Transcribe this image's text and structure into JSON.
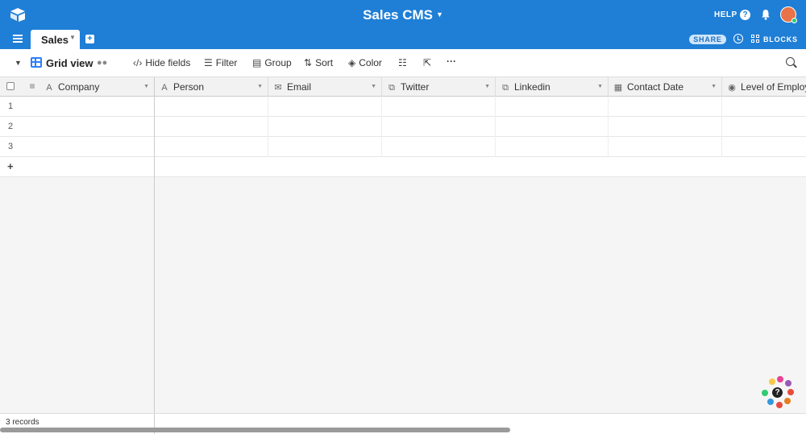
{
  "app": {
    "base_title": "Sales CMS",
    "help_label": "HELP",
    "share_label": "SHARE",
    "blocks_label": "BLOCKS",
    "tabs": [
      {
        "label": "Sales"
      }
    ]
  },
  "toolbar": {
    "view_name": "Grid view",
    "hide_fields": "Hide fields",
    "filter": "Filter",
    "group": "Group",
    "sort": "Sort",
    "color": "Color",
    "more": "···"
  },
  "grid": {
    "primary_column": {
      "label": "Company",
      "icon": "text-icon"
    },
    "columns": [
      {
        "label": "Person",
        "icon": "text-icon"
      },
      {
        "label": "Email",
        "icon": "email-icon"
      },
      {
        "label": "Twitter",
        "icon": "link-icon"
      },
      {
        "label": "Linkedin",
        "icon": "link-icon"
      },
      {
        "label": "Contact Date",
        "icon": "calendar-icon"
      },
      {
        "label": "Level of Employme",
        "icon": "select-icon"
      }
    ],
    "rows": [
      {
        "num": "1"
      },
      {
        "num": "2"
      },
      {
        "num": "3"
      }
    ],
    "add_row": "+"
  },
  "footer": {
    "records": "3 records"
  },
  "colors": {
    "header_bg": "#1f7fd6",
    "accent": "#2d7ff9"
  }
}
